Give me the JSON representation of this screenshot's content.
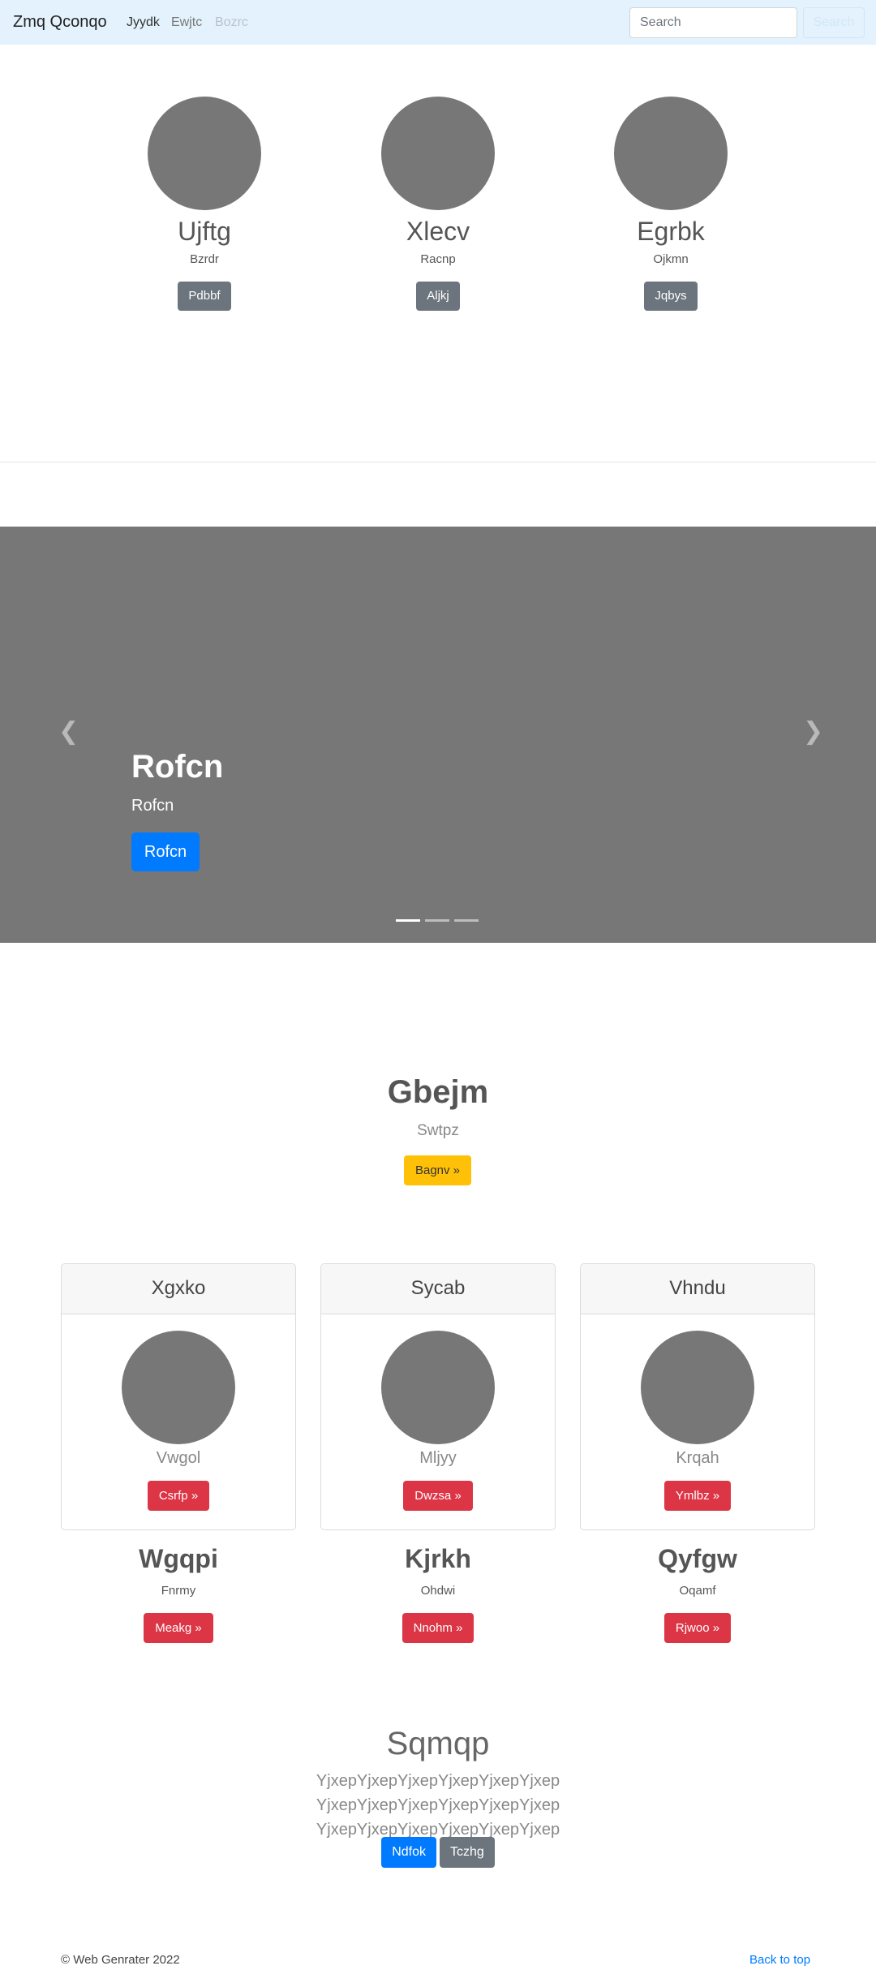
{
  "navbar": {
    "brand": "Zmq Qconqo",
    "links": [
      "Jyydk",
      "Ewjtc",
      "Bozrc"
    ],
    "search_placeholder": "Search",
    "search_button": "Search"
  },
  "profiles": [
    {
      "name": "Ujftg",
      "sub": "Bzrdr",
      "button": "Pdbbf"
    },
    {
      "name": "Xlecv",
      "sub": "Racnp",
      "button": "Aljkj"
    },
    {
      "name": "Egrbk",
      "sub": "Ojkmn",
      "button": "Jqbys"
    }
  ],
  "carousel": {
    "title": "Rofcn",
    "subtitle": "Rofcn",
    "button": "Rofcn",
    "prev_icon": "chevron-left-icon",
    "next_icon": "chevron-right-icon",
    "slides": 3,
    "active_slide": 1
  },
  "hero": {
    "title": "Gbejm",
    "subtitle": "Swtpz",
    "button": "Bagnv »"
  },
  "cards": [
    {
      "header": "Xgxko",
      "sub": "Vwgol",
      "button": "Csrfp »"
    },
    {
      "header": "Sycab",
      "sub": "Mljyy",
      "button": "Dwzsa »"
    },
    {
      "header": "Vhndu",
      "sub": "Krqah",
      "button": "Ymlbz »"
    }
  ],
  "columns": [
    {
      "title": "Wgqpi",
      "sub": "Fnrmy",
      "button": "Meakg »"
    },
    {
      "title": "Kjrkh",
      "sub": "Ohdwi",
      "button": "Nnohm »"
    },
    {
      "title": "Qyfgw",
      "sub": "Oqamf",
      "button": "Rjwoo »"
    }
  ],
  "bottom": {
    "title": "Sqmqp",
    "text": "YjxepYjxepYjxepYjxepYjxepYjxep YjxepYjxepYjxepYjxepYjxepYjxep YjxepYjxepYjxepYjxepYjxepYjxep",
    "primary_button": "Ndfok",
    "secondary_button": "Tczhg"
  },
  "footer": {
    "copyright": "© Web Genrater 2022",
    "back_to_top": "Back to top"
  },
  "colors": {
    "navbar_bg": "#e3f2fd",
    "placeholder_grey": "#777777",
    "primary": "#007bff",
    "secondary": "#6c757d",
    "danger": "#dc3545",
    "warning": "#ffc107"
  }
}
